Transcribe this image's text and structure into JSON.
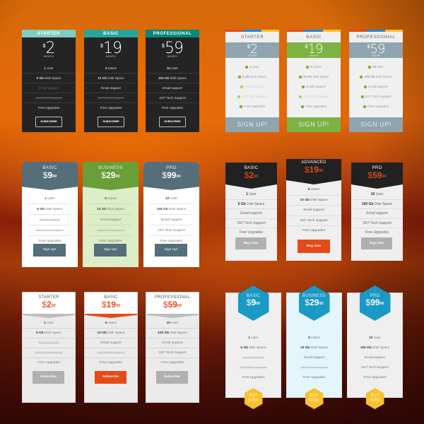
{
  "colors": {
    "g1_header_light": "#7ecdc4",
    "g1_header_mid": "#26a69a",
    "g1_header_dark": "#00897b",
    "g1_card": "#242424",
    "g2_stripe": [
      "#e64a19",
      "#1e88e5",
      "#fbc02d"
    ],
    "g2_slate": "#90a4ae",
    "g2_green": "#7cb342",
    "g3_slate": "#546e7a",
    "g3_green": "#689f38",
    "g3_green_body": "#dcedc8",
    "accent_red": "#e64a19",
    "g4_dark": "#212121",
    "button_grey": "#b0b0b0",
    "g6_blue": "#1a99c4",
    "g6_yellow": "#fbc02d",
    "g6_highlight_body": "#e3f6fb"
  },
  "groups": [
    {
      "style": "dark-subscribe",
      "button_label": "SUBSCRIBE",
      "period_label": "MONTH",
      "plans": [
        {
          "name": "STARTER",
          "currency": "$",
          "price": "2",
          "features": [
            {
              "bold": "1",
              "text": " User",
              "enabled": true
            },
            {
              "bold": "5 Gb",
              "text": " Disk Space",
              "enabled": true
            },
            {
              "bold": "",
              "text": "Email support",
              "enabled": false
            },
            {
              "bold": "",
              "text": "24/7 Tech Support",
              "enabled": false
            },
            {
              "bold": "",
              "text": "Free Upgrades",
              "enabled": true
            }
          ]
        },
        {
          "name": "BASIC",
          "currency": "$",
          "price": "19",
          "features": [
            {
              "bold": "5",
              "text": " Users",
              "enabled": true
            },
            {
              "bold": "10 Gb",
              "text": " Disk Space",
              "enabled": true
            },
            {
              "bold": "",
              "text": "Email support",
              "enabled": true
            },
            {
              "bold": "",
              "text": "24/7 Tech Support",
              "enabled": false
            },
            {
              "bold": "",
              "text": "Free Upgrades",
              "enabled": true
            }
          ]
        },
        {
          "name": "PROFESSIONAL",
          "currency": "$",
          "price": "59",
          "features": [
            {
              "bold": "10",
              "text": " User",
              "enabled": true
            },
            {
              "bold": "100 Gb",
              "text": " Disk Space",
              "enabled": true
            },
            {
              "bold": "",
              "text": "Email support",
              "enabled": true
            },
            {
              "bold": "",
              "text": "24/7 Tech Support",
              "enabled": true
            },
            {
              "bold": "",
              "text": "Free Upgrades",
              "enabled": true
            }
          ]
        }
      ]
    },
    {
      "style": "light-signup-icons",
      "button_label": "SIGN UP!",
      "period_label": "MONTH",
      "feature_icons": [
        "user-icon",
        "cloud-icon",
        "envelope-icon",
        "headset-icon",
        "gift-icon"
      ],
      "plans": [
        {
          "name": "STARTER",
          "currency": "$",
          "price": "2",
          "highlighted": false,
          "features": [
            {
              "bold": "1",
              "text": " User",
              "enabled": true
            },
            {
              "bold": "5 Gb",
              "text": " Disk Space",
              "enabled": true
            },
            {
              "bold": "",
              "text": "Email support",
              "enabled": false
            },
            {
              "bold": "",
              "text": "24/7 Tech Support",
              "enabled": false
            },
            {
              "bold": "",
              "text": "Free Upgrades",
              "enabled": true
            }
          ]
        },
        {
          "name": "BASIC",
          "currency": "$",
          "price": "19",
          "highlighted": true,
          "features": [
            {
              "bold": "5",
              "text": " Users",
              "enabled": true
            },
            {
              "bold": "10 Gb",
              "text": " Disk Space",
              "enabled": true
            },
            {
              "bold": "",
              "text": "Email support",
              "enabled": true
            },
            {
              "bold": "",
              "text": "24/7 Tech Support",
              "enabled": false
            },
            {
              "bold": "",
              "text": "Free Upgrades",
              "enabled": true
            }
          ]
        },
        {
          "name": "PROFESSIONAL",
          "currency": "$",
          "price": "59",
          "highlighted": false,
          "features": [
            {
              "bold": "10",
              "text": " User",
              "enabled": true
            },
            {
              "bold": "100 Gb",
              "text": " Disk Space",
              "enabled": true
            },
            {
              "bold": "",
              "text": "Email support",
              "enabled": true
            },
            {
              "bold": "",
              "text": "24/7 Tech Support",
              "enabled": true
            },
            {
              "bold": "",
              "text": "Free Upgrades",
              "enabled": true
            }
          ]
        }
      ]
    },
    {
      "style": "rounded-signup",
      "button_label": "Sign Up!",
      "plans": [
        {
          "name": "BASIC",
          "currency": "$",
          "price": "9",
          "cents": "00",
          "highlighted": false,
          "features": [
            {
              "bold": "1",
              "text": " User",
              "enabled": true
            },
            {
              "bold": "5 Gb",
              "text": " Disk Space",
              "enabled": true
            },
            {
              "bold": "",
              "text": "Email support",
              "enabled": false
            },
            {
              "bold": "",
              "text": "24/7 Tech Support",
              "enabled": false
            },
            {
              "bold": "",
              "text": "Free Upgrades",
              "enabled": true
            }
          ]
        },
        {
          "name": "BUSINESS",
          "currency": "$",
          "price": "29",
          "cents": "00",
          "highlighted": true,
          "features": [
            {
              "bold": "5",
              "text": " Users",
              "enabled": true
            },
            {
              "bold": "10 Gb",
              "text": " Disk Space",
              "enabled": true
            },
            {
              "bold": "",
              "text": "Email support",
              "enabled": true
            },
            {
              "bold": "",
              "text": "24/7 Tech Support",
              "enabled": false
            },
            {
              "bold": "",
              "text": "Free Upgrades",
              "enabled": true
            }
          ]
        },
        {
          "name": "PRO",
          "currency": "$",
          "price": "99",
          "cents": "00",
          "highlighted": false,
          "features": [
            {
              "bold": "10",
              "text": " User",
              "enabled": true
            },
            {
              "bold": "100 Gb",
              "text": " Disk Space",
              "enabled": true
            },
            {
              "bold": "",
              "text": "Email support",
              "enabled": true
            },
            {
              "bold": "",
              "text": "24/7 Tech Support",
              "enabled": true
            },
            {
              "bold": "",
              "text": "Free Upgrades",
              "enabled": true
            }
          ]
        }
      ]
    },
    {
      "style": "dark-header-buynow",
      "button_label": "Buy now",
      "plans": [
        {
          "name": "BASIC",
          "currency": "$",
          "price": "2",
          "cents": "00",
          "highlighted": false,
          "features": [
            {
              "bold": "1",
              "text": " User",
              "enabled": true
            },
            {
              "bold": "5 Gb",
              "text": " Disk Space",
              "enabled": true
            },
            {
              "bold": "",
              "text": "Email support",
              "enabled": true
            },
            {
              "bold": "",
              "text": "24/7 Tech Support",
              "enabled": true
            },
            {
              "bold": "",
              "text": "Free Upgrades",
              "enabled": true
            }
          ]
        },
        {
          "name": "ADVANCED",
          "currency": "$",
          "price": "19",
          "cents": "00",
          "highlighted": true,
          "features": [
            {
              "bold": "5",
              "text": " Users",
              "enabled": true
            },
            {
              "bold": "10 Gb",
              "text": " Disk Space",
              "enabled": true
            },
            {
              "bold": "",
              "text": "Email support",
              "enabled": true
            },
            {
              "bold": "",
              "text": "24/7 Tech Support",
              "enabled": true
            },
            {
              "bold": "",
              "text": "Free Upgrades",
              "enabled": true
            }
          ]
        },
        {
          "name": "PRO",
          "currency": "$",
          "price": "59",
          "cents": "00",
          "highlighted": false,
          "features": [
            {
              "bold": "10",
              "text": " User",
              "enabled": true
            },
            {
              "bold": "100 Gb",
              "text": " Disk Space",
              "enabled": true
            },
            {
              "bold": "",
              "text": "Email support",
              "enabled": true
            },
            {
              "bold": "",
              "text": "24/7 Tech Support",
              "enabled": true
            },
            {
              "bold": "",
              "text": "Free Upgrades",
              "enabled": true
            }
          ]
        }
      ]
    },
    {
      "style": "white-chevron-subscribe",
      "button_label": "Subscribe",
      "plans": [
        {
          "name": "STARTER",
          "currency": "$",
          "price": "2",
          "cents": "00",
          "highlighted": false,
          "features": [
            {
              "bold": "1",
              "text": " User",
              "enabled": true
            },
            {
              "bold": "5 Gb",
              "text": " Disk Space",
              "enabled": true
            },
            {
              "bold": "",
              "text": "Email support",
              "enabled": false
            },
            {
              "bold": "",
              "text": "24/7 Tech Support",
              "enabled": false
            },
            {
              "bold": "",
              "text": "Free Upgrades",
              "enabled": true
            }
          ]
        },
        {
          "name": "BASIC",
          "currency": "$",
          "price": "19",
          "cents": "00",
          "highlighted": true,
          "features": [
            {
              "bold": "5",
              "text": " Users",
              "enabled": true
            },
            {
              "bold": "10 Gb",
              "text": " Disk Space",
              "enabled": true
            },
            {
              "bold": "",
              "text": "Email support",
              "enabled": true
            },
            {
              "bold": "",
              "text": "24/7 Tech Support",
              "enabled": false
            },
            {
              "bold": "",
              "text": "Free Upgrades",
              "enabled": true
            }
          ]
        },
        {
          "name": "PROFESSIONAL",
          "currency": "$",
          "price": "59",
          "cents": "00",
          "highlighted": false,
          "features": [
            {
              "bold": "10",
              "text": " User",
              "enabled": true
            },
            {
              "bold": "100 Gb",
              "text": " Disk Space",
              "enabled": true
            },
            {
              "bold": "",
              "text": "Email support",
              "enabled": true
            },
            {
              "bold": "",
              "text": "24/7 Tech Support",
              "enabled": true
            },
            {
              "bold": "",
              "text": "Free Upgrades",
              "enabled": true
            }
          ]
        }
      ]
    },
    {
      "style": "hexagon-buynow",
      "button_label": "BUY NOW",
      "button_lines": [
        "BUY",
        "NOW"
      ],
      "plans": [
        {
          "name": "BASIC",
          "currency": "$",
          "price": "9",
          "cents": "00",
          "highlighted": false,
          "features": [
            {
              "bold": "1",
              "text": " User",
              "enabled": true
            },
            {
              "bold": "5 Gb",
              "text": " Disk Space",
              "enabled": true
            },
            {
              "bold": "",
              "text": "Email support",
              "enabled": false
            },
            {
              "bold": "",
              "text": "24/7 Tech Support",
              "enabled": false
            },
            {
              "bold": "",
              "text": "Free Upgrades",
              "enabled": true
            }
          ]
        },
        {
          "name": "BUSINESS",
          "currency": "$",
          "price": "29",
          "cents": "00",
          "highlighted": true,
          "features": [
            {
              "bold": "5",
              "text": " Users",
              "enabled": true
            },
            {
              "bold": "10 Gb",
              "text": " Disk Space",
              "enabled": true
            },
            {
              "bold": "",
              "text": "Email support",
              "enabled": true
            },
            {
              "bold": "",
              "text": "24/7 Tech Support",
              "enabled": false
            },
            {
              "bold": "",
              "text": "Free Upgrades",
              "enabled": true
            }
          ]
        },
        {
          "name": "PRO",
          "currency": "$",
          "price": "99",
          "cents": "00",
          "highlighted": false,
          "features": [
            {
              "bold": "10",
              "text": " User",
              "enabled": true
            },
            {
              "bold": "100 Gb",
              "text": " Disk Space",
              "enabled": true
            },
            {
              "bold": "",
              "text": "Email support",
              "enabled": true
            },
            {
              "bold": "",
              "text": "24/7 Tech Support",
              "enabled": true
            },
            {
              "bold": "",
              "text": "Free Upgrades",
              "enabled": true
            }
          ]
        }
      ]
    }
  ]
}
